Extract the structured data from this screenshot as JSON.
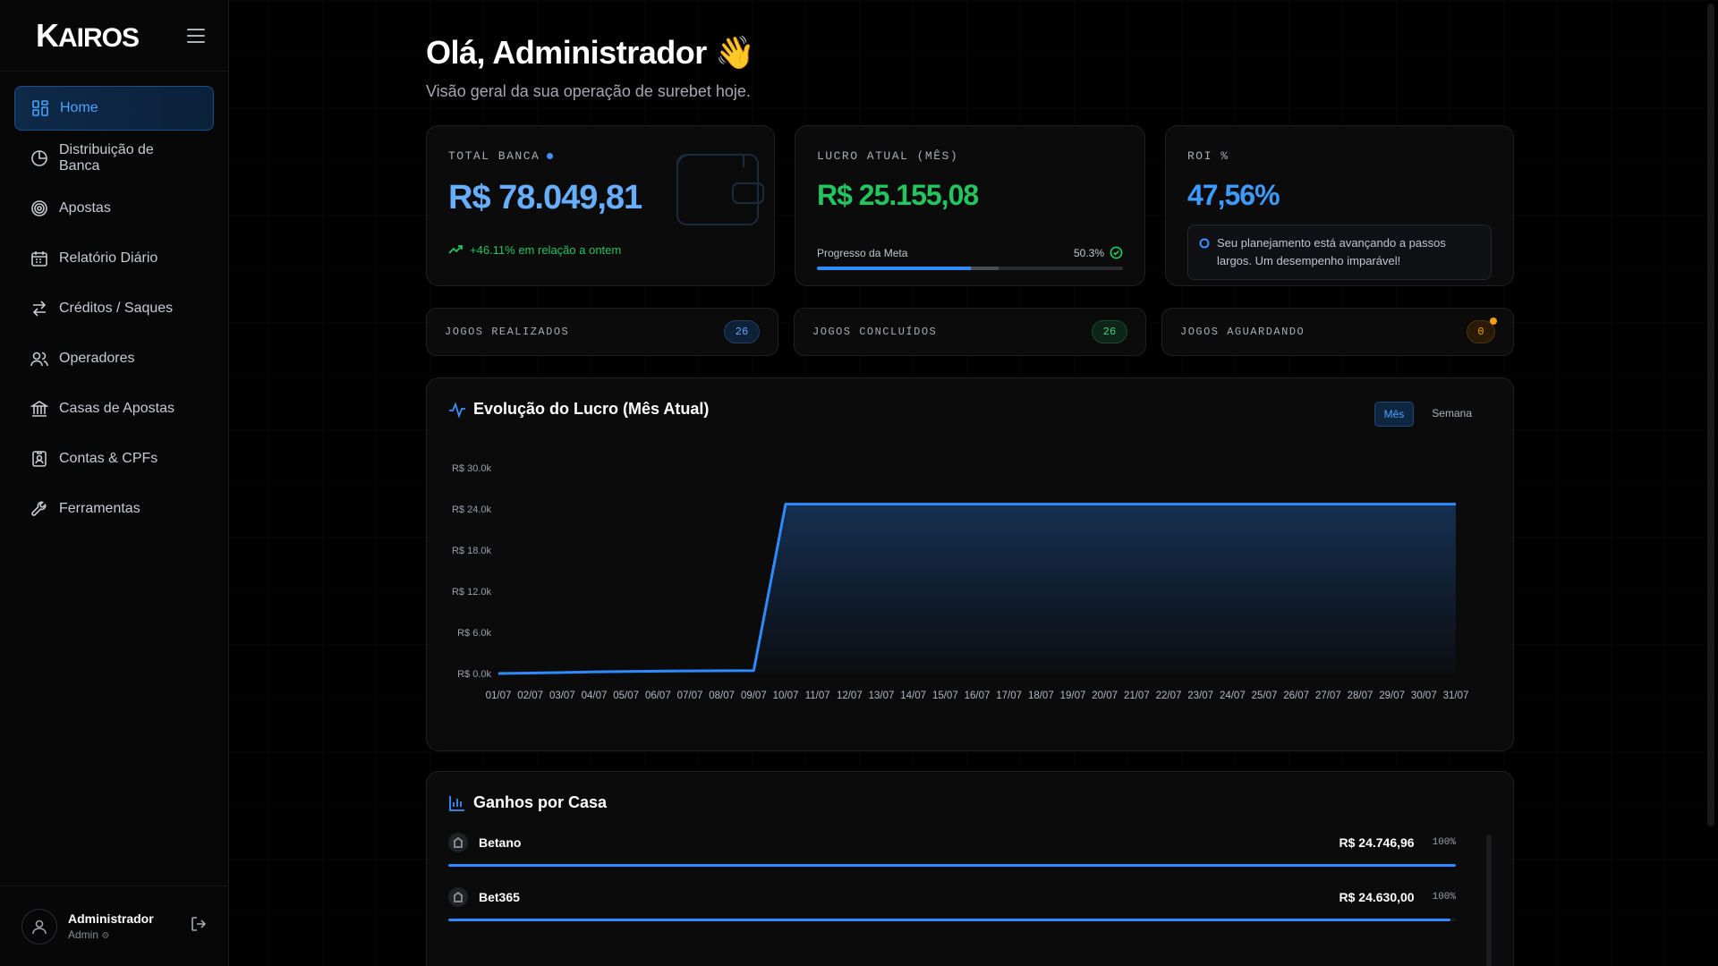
{
  "brand": {
    "logo_k": "K",
    "logo_rest": "AIROS"
  },
  "sidebar": {
    "items": [
      {
        "label": "Home",
        "icon": "grid-icon",
        "active": true
      },
      {
        "label": "Distribuição de Banca",
        "icon": "pie-chart-icon"
      },
      {
        "label": "Apostas",
        "icon": "target-icon"
      },
      {
        "label": "Relatório Diário",
        "icon": "calendar-icon"
      },
      {
        "label": "Créditos / Saques",
        "icon": "arrows-exchange-icon"
      },
      {
        "label": "Operadores",
        "icon": "users-icon"
      },
      {
        "label": "Casas de Apostas",
        "icon": "bank-icon"
      },
      {
        "label": "Contas & CPFs",
        "icon": "id-card-icon"
      },
      {
        "label": "Ferramentas",
        "icon": "wrench-icon"
      }
    ]
  },
  "user": {
    "name": "Administrador",
    "role": "Admin"
  },
  "header": {
    "greeting": "Olá, Administrador 👋",
    "subtitle": "Visão geral da sua operação de surebet hoje."
  },
  "stats": {
    "total_banca": {
      "label": "TOTAL BANCA",
      "value": "R$ 78.049,81",
      "trend": "+46.11% em relação a ontem"
    },
    "lucro": {
      "label": "LUCRO ATUAL (MÊS)",
      "value": "R$ 25.155,08",
      "progress_label": "Progresso da Meta",
      "progress_pct": "50.3%",
      "progress_fraction": 0.503
    },
    "roi": {
      "label": "ROI %",
      "value": "47,56%",
      "note": "Seu planejamento está avançando a passos largos. Um desempenho imparável!"
    }
  },
  "games": {
    "realizados": {
      "label": "JOGOS REALIZADOS",
      "count": "26"
    },
    "concluidos": {
      "label": "JOGOS CONCLUÍDOS",
      "count": "26"
    },
    "aguardando": {
      "label": "JOGOS AGUARDANDO",
      "count": "0"
    }
  },
  "chart_section": {
    "title": "Evolução do Lucro (Mês Atual)",
    "toggle": [
      "Mês",
      "Semana"
    ],
    "active_toggle": "Mês"
  },
  "chart_data": {
    "type": "area",
    "title": "Evolução do Lucro (Mês Atual)",
    "x": [
      "01/07",
      "02/07",
      "03/07",
      "04/07",
      "05/07",
      "06/07",
      "07/07",
      "08/07",
      "09/07",
      "10/07",
      "11/07",
      "12/07",
      "13/07",
      "14/07",
      "15/07",
      "16/07",
      "17/07",
      "18/07",
      "19/07",
      "20/07",
      "21/07",
      "22/07",
      "23/07",
      "24/07",
      "25/07",
      "26/07",
      "27/07",
      "28/07",
      "29/07",
      "30/07",
      "31/07"
    ],
    "values": [
      0,
      60,
      150,
      250,
      300,
      350,
      380,
      400,
      420,
      24700,
      24700,
      24700,
      24700,
      24700,
      24700,
      24700,
      24700,
      24700,
      24700,
      24700,
      24700,
      24700,
      24700,
      24700,
      24700,
      24700,
      24700,
      24700,
      24700,
      24700,
      24700
    ],
    "yticks": [
      "R$ 0.0k",
      "R$ 6.0k",
      "R$ 12.0k",
      "R$ 18.0k",
      "R$ 24.0k",
      "R$ 30.0k"
    ],
    "ylim": [
      0,
      30000
    ],
    "grid": false,
    "color": "#2e8bff"
  },
  "houses": {
    "title": "Ganhos por Casa",
    "items": [
      {
        "name": "Betano",
        "value": "R$ 24.746,96",
        "pct": "100%",
        "fraction": 1.0
      },
      {
        "name": "Bet365",
        "value": "R$ 24.630,00",
        "pct": "100%",
        "fraction": 0.995
      }
    ]
  }
}
